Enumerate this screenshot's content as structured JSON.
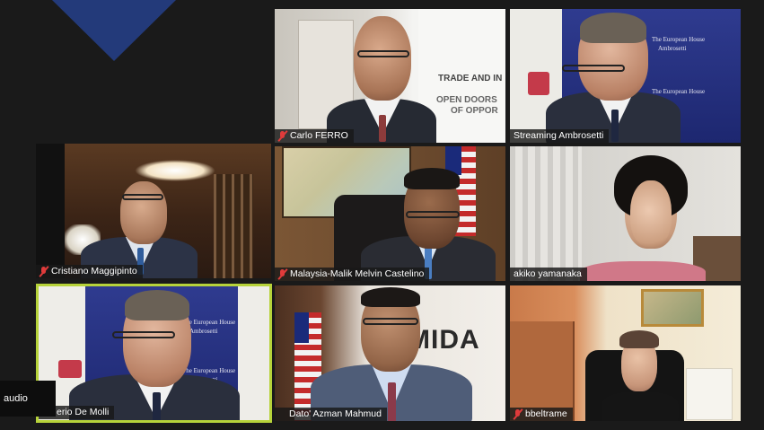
{
  "participants": [
    {
      "name": "Carlo FERRO",
      "muted": true,
      "sign_line1": "TRADE AND IN",
      "sign_line2": "OPEN DOORS",
      "sign_line3": "OF OPPOR"
    },
    {
      "name": "Streaming Ambrosetti",
      "muted": false,
      "banner_line1": "The European House",
      "banner_line2": "Ambrosetti"
    },
    {
      "name": "Cristiano Maggipinto",
      "muted": true
    },
    {
      "name": "Malaysia-Malik Melvin Castelino",
      "muted": true
    },
    {
      "name": "akiko yamanaka",
      "muted": false
    },
    {
      "name": "erio De Molli",
      "muted": false,
      "active_speaker": true,
      "banner_line1": "The European House",
      "banner_line2": "Ambrosetti"
    },
    {
      "name": "Dato' Azman Mahmud",
      "muted": false,
      "sign_text": "MIDA"
    },
    {
      "name": "bbeltrame",
      "muted": true
    }
  ],
  "controls": {
    "audio_label": "audio"
  },
  "colors": {
    "active_border": "#b7d33a",
    "mute_red": "#e03b3b"
  }
}
